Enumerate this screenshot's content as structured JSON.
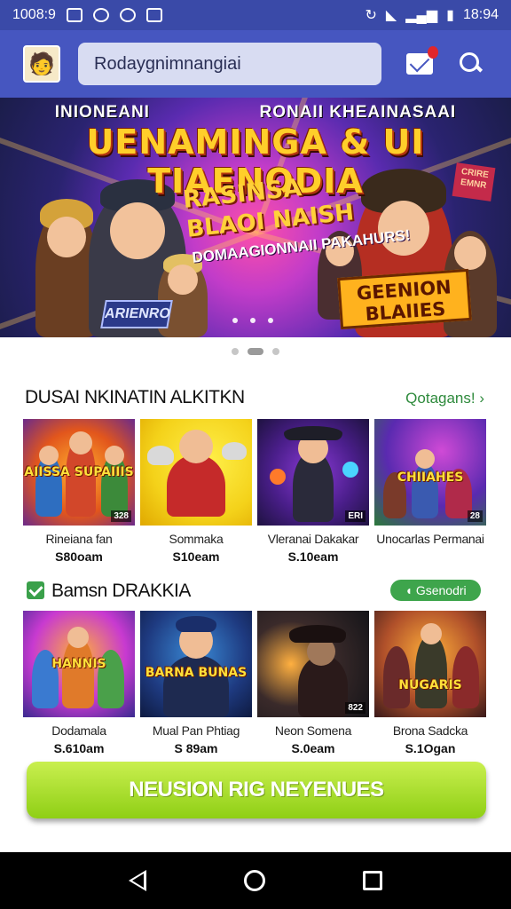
{
  "status_bar": {
    "time_left": "1008:9",
    "time_right": "18:94"
  },
  "app_bar": {
    "search_value": "Rodaygnimnangiai",
    "notification_count": ""
  },
  "banner": {
    "top_left": "INIONEANI",
    "top_right": "RONAII KHEAINASAAI",
    "headline": "UENAMINGA & UI TIAENODIA",
    "promo_line1": "RASINSA",
    "promo_line2": "BLAOI NAISH",
    "promo_line3": "DOMAAGIONNAII PAKAHURS!",
    "badge_left": "ARIENRO",
    "badge_right": "GEENION BLAIIES",
    "flag_text": "CRIRE EMNR"
  },
  "section1": {
    "title": "DUSAI NKINATIN ALKITKN",
    "link": "Qotagans! ›",
    "cards": [
      {
        "title_art": "AIISSA SUPAIIIS",
        "tag": "328",
        "name": "Rineiana fan",
        "price": "S80oam"
      },
      {
        "title_art": "",
        "tag": "",
        "name": "Sommaka",
        "price": "S10eam"
      },
      {
        "title_art": "",
        "tag": "ERI",
        "name": "Vleranai Dakakar",
        "price": "S.10eam"
      },
      {
        "title_art": "CHIIAHES",
        "tag": "28",
        "name": "Unocarlas Permanai",
        "price": ""
      }
    ]
  },
  "section2": {
    "title": "Bamsn DRAKKIA",
    "pill": "Gsenodri",
    "cards": [
      {
        "title_art": "HANNIS",
        "tag": "",
        "name": "Dodamala",
        "price": "S.610am"
      },
      {
        "title_art": "BARNA BUNAS",
        "tag": "",
        "name": "Mual Pan Phtiag",
        "price": "S 89am"
      },
      {
        "title_art": "",
        "tag": "822",
        "name": "Neon Somena",
        "price": "S.0eam"
      },
      {
        "title_art": "NUGARIS",
        "tag": "",
        "name": "Brona Sadcka",
        "price": "S.1Ogan"
      }
    ]
  },
  "cta": {
    "label": "NEUSION RIG NEYENUES"
  },
  "colors": {
    "appbar": "#4656c0",
    "accent_green": "#3ea54c",
    "cta": "#a6dc28"
  }
}
